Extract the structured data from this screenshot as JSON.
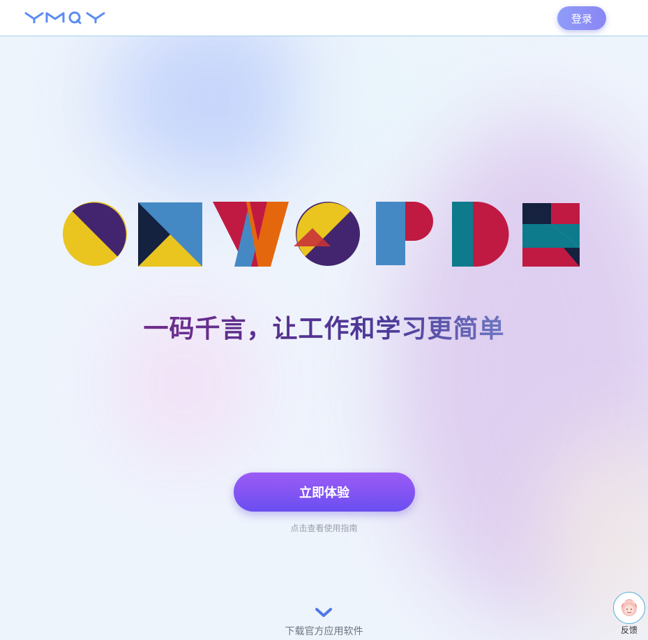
{
  "header": {
    "logo_text": "YMQY",
    "login_label": "登录"
  },
  "hero": {
    "brand_letters": "OKWOPDS",
    "slogan": "一码千言，让工作和学习更简单",
    "cta_label": "立即体验",
    "guide_link": "点击查看使用指南"
  },
  "footer": {
    "download_label": "下载官方应用软件"
  },
  "feedback": {
    "label": "反馈"
  },
  "colors": {
    "accent_purple": "#7a52f2",
    "brand_yellow": "#eac41f",
    "brand_indigo": "#43256f",
    "brand_red": "#c01a42",
    "brand_blue": "#4589c4",
    "brand_orange": "#e4670e",
    "brand_teal": "#0d7b8c",
    "brand_navy": "#14213f"
  },
  "icons": [
    "logo",
    "chevron-down-icon",
    "support-avatar-icon"
  ]
}
